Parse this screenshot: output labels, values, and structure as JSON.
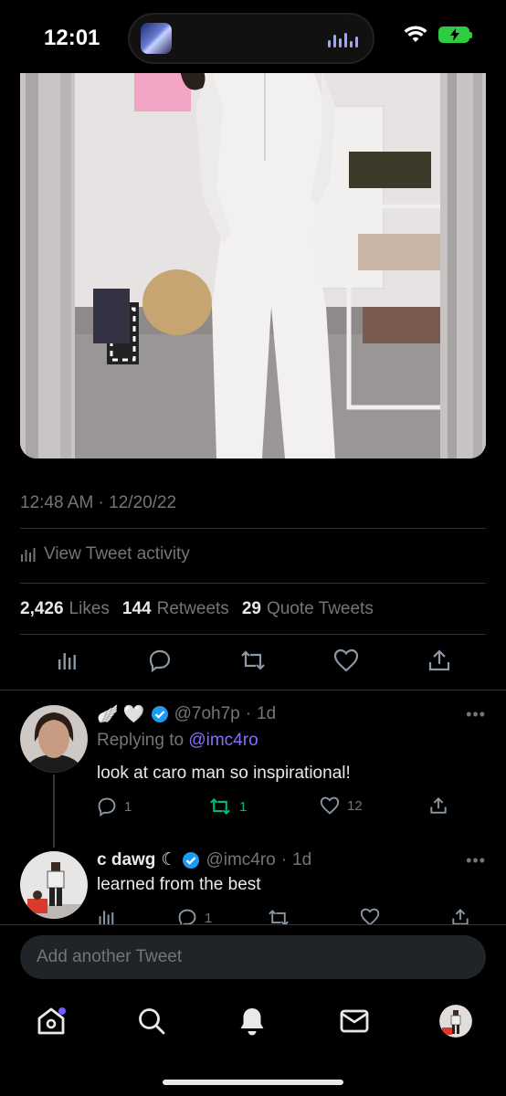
{
  "status_bar": {
    "time": "12:01"
  },
  "tweet": {
    "timestamp": "12:48 AM · 12/20/22",
    "activity_label": "View Tweet activity",
    "stats": [
      {
        "count": "2,426",
        "label": "Likes"
      },
      {
        "count": "144",
        "label": "Retweets"
      },
      {
        "count": "29",
        "label": "Quote Tweets"
      }
    ]
  },
  "replies": [
    {
      "display_name_emojis": "🪽 🤍",
      "handle": "@7oh7p",
      "age": "1d",
      "replying_to_prefix": "Replying to",
      "replying_to": "@imc4ro",
      "text": "look at caro man so inspirational!",
      "reply_count": "1",
      "retweet_count": "1",
      "like_count": "12"
    },
    {
      "display_name": "c dawg",
      "name_symbol": "☾",
      "handle": "@imc4ro",
      "age": "1d",
      "text": "learned from the best",
      "reply_count": "1"
    }
  ],
  "composer": {
    "placeholder": "Add another Tweet"
  },
  "more_label": "•••",
  "colors": {
    "background": "#000000",
    "accent": "#1d9bf0",
    "retweet_green": "#00ba7c",
    "mention_purple": "#8a6cff",
    "muted": "#71767b"
  }
}
